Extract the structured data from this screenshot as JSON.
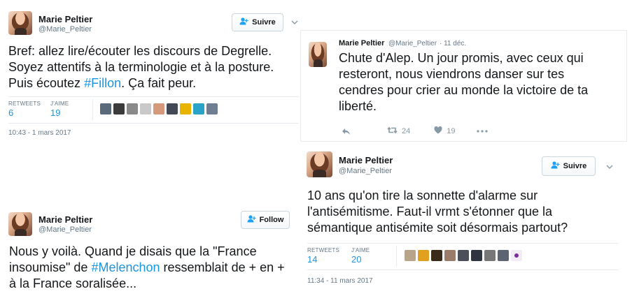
{
  "tweet1": {
    "name": "Marie Peltier",
    "handle": "@Marie_Peltier",
    "follow_label": "Suivre",
    "text_parts": [
      "Bref: allez lire/écouter les discours de Degrelle. Soyez attentifs à la terminologie et à la posture. Puis écoutez ",
      "#Fillon",
      ". Ça fait peur."
    ],
    "retweets_label": "RETWEETS",
    "retweets": "6",
    "likes_label": "J'AIME",
    "likes": "19",
    "timestamp": "10:43 - 1 mars 2017"
  },
  "tweet2": {
    "name": "Marie Peltier",
    "handle": "@Marie_Peltier",
    "date": "· 11 déc.",
    "text": "Chute d'Alep. Un jour promis, avec ceux qui resteront, nous viendrons danser sur tes cendres pour crier au monde la victoire de ta liberté.",
    "retweet_count": "24",
    "like_count": "19"
  },
  "tweet3": {
    "name": "Marie Peltier",
    "handle": "@Marie_Peltier",
    "follow_label": "Suivre",
    "text": "10 ans qu'on tire la sonnette d'alarme sur l'antisémitisme. Faut-il vrmt s'étonner que la sémantique antisémite soit désormais partout?",
    "retweets_label": "RETWEETS",
    "retweets": "14",
    "likes_label": "J'AIME",
    "likes": "20",
    "timestamp": "11:34 - 11 mars 2017"
  },
  "tweet4": {
    "name": "Marie Peltier",
    "handle": "@Marie_Peltier",
    "follow_label": "Follow",
    "text_parts": [
      "Nous y voilà. Quand je disais que la \"France insoumise\" de ",
      "#Melenchon",
      " ressemblait de + en + à la France soralisée..."
    ]
  },
  "colors": {
    "link": "#1b95e0",
    "muted": "#657786",
    "border": "#e6ecf0"
  },
  "icons": [
    "add-user-icon",
    "chevron-down-icon",
    "reply-icon",
    "retweet-icon",
    "heart-icon",
    "more-icon"
  ]
}
